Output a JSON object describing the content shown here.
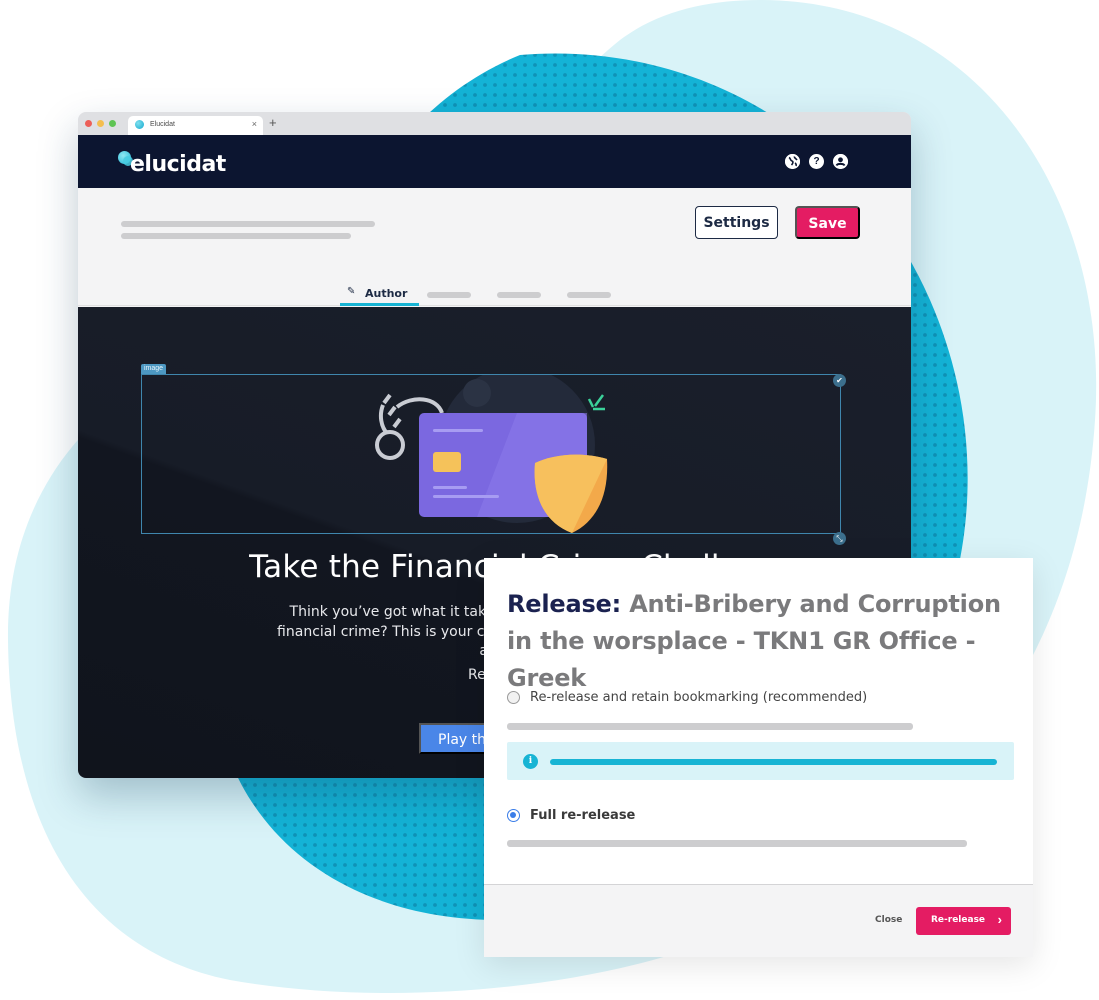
{
  "colors": {
    "brand_pink": "#e41c63",
    "brand_navy": "#0c1530",
    "accent_cyan": "#17b4d4",
    "play_blue": "#4a86e8",
    "bg_light_cyan": "#d9f3f8"
  },
  "browser": {
    "tab_title": "Elucidat",
    "tab_close_icon": "×",
    "new_tab_icon": "+"
  },
  "header": {
    "logo_text": "elucidat",
    "icons": [
      {
        "name": "globe-icon",
        "glyph": "◐"
      },
      {
        "name": "help-icon",
        "glyph": "?"
      },
      {
        "name": "user-icon",
        "glyph": "●"
      }
    ]
  },
  "toolbar": {
    "settings_label": "Settings",
    "save_label": "Save",
    "tabs": [
      {
        "label": "Author",
        "icon": "pencil-icon",
        "active": true
      },
      {
        "label": "",
        "active": false
      },
      {
        "label": "",
        "active": false
      },
      {
        "label": "",
        "active": false
      }
    ]
  },
  "content": {
    "image_tag": "image",
    "check_glyph": "✔",
    "resize_glyph": "⤡",
    "title": "Take the Financial Crime Challenge",
    "body_lines": [
      "Think you’ve got what it takes to stop the fraudsters",
      "financial crime? This is your chance to prove it. Work t",
      "and see if you can collect"
    ],
    "partial_text": "Re",
    "play_label": "Play the"
  },
  "dialog": {
    "title_keyword": "Release:",
    "title_name": "Anti-Bribery and Corruption in the worsplace - TKN1 GR Office - Greek",
    "options": [
      {
        "label": "Re-release and retain bookmarking (recommended)",
        "selected": false
      },
      {
        "label": "Full re-release",
        "selected": true
      }
    ],
    "info_icon": "i",
    "close_label": "Close",
    "rerelease_label": "Re-release",
    "chevron": "›"
  }
}
